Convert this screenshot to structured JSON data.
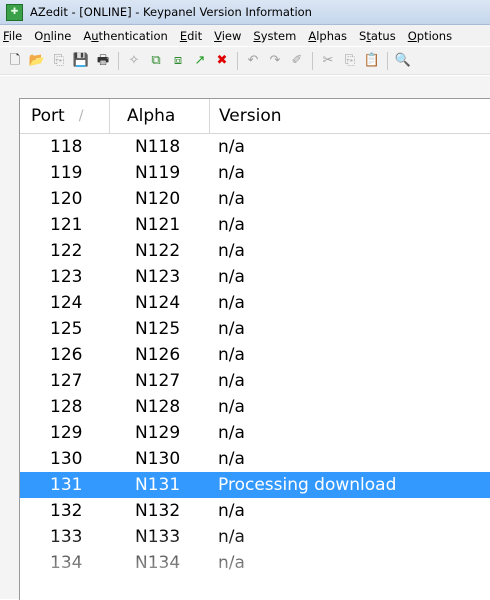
{
  "window": {
    "app_icon_glyph": "✚",
    "title": "AZedit - [ONLINE] - Keypanel Version Information"
  },
  "menu": [
    {
      "pre": "",
      "u": "F",
      "post": "ile"
    },
    {
      "pre": "O",
      "u": "n",
      "post": "line"
    },
    {
      "pre": "A",
      "u": "u",
      "post": "thentication"
    },
    {
      "pre": "",
      "u": "E",
      "post": "dit"
    },
    {
      "pre": "",
      "u": "V",
      "post": "iew"
    },
    {
      "pre": "",
      "u": "S",
      "post": "ystem"
    },
    {
      "pre": "",
      "u": "A",
      "post": "lphas"
    },
    {
      "pre": "S",
      "u": "t",
      "post": "atus"
    },
    {
      "pre": "",
      "u": "O",
      "post": "ptions"
    }
  ],
  "toolbar": [
    {
      "icon": "new-file-icon",
      "glyph": "🗋",
      "color": "#333333"
    },
    {
      "icon": "open-folder-icon",
      "glyph": "📂",
      "color": "#d9a300"
    },
    {
      "icon": "copy-file-icon",
      "glyph": "⎘",
      "color": "#9a9a9a"
    },
    {
      "icon": "save-icon",
      "glyph": "💾",
      "color": "#222222"
    },
    {
      "icon": "print-icon",
      "glyph": "🖶",
      "color": "#333333"
    },
    {
      "sep": true
    },
    {
      "icon": "wand-icon",
      "glyph": "✧",
      "color": "#9a9a9a"
    },
    {
      "icon": "copy-green-icon",
      "glyph": "⧉",
      "color": "#2e8b2e"
    },
    {
      "icon": "paste-green-icon",
      "glyph": "⧈",
      "color": "#2e8b2e"
    },
    {
      "icon": "arrow-green-icon",
      "glyph": "↗",
      "color": "#1f9a1f"
    },
    {
      "icon": "delete-icon",
      "glyph": "✖",
      "color": "#e00000"
    },
    {
      "sep": true
    },
    {
      "icon": "undo-icon",
      "glyph": "↶",
      "color": "#a0a0a0"
    },
    {
      "icon": "redo-icon",
      "glyph": "↷",
      "color": "#a0a0a0"
    },
    {
      "icon": "eraser-icon",
      "glyph": "✐",
      "color": "#a0a0a0"
    },
    {
      "sep": true
    },
    {
      "icon": "cut-icon",
      "glyph": "✂",
      "color": "#a0a0a0"
    },
    {
      "icon": "copy-icon",
      "glyph": "⎘",
      "color": "#a0a0a0"
    },
    {
      "icon": "paste-icon",
      "glyph": "📋",
      "color": "#a0a0a0"
    },
    {
      "sep": true
    },
    {
      "icon": "search-icon",
      "glyph": "🔍",
      "color": "#333333"
    }
  ],
  "table": {
    "columns": {
      "port": "Port",
      "alpha": "Alpha",
      "version": "Version"
    },
    "sort_indicator": "/",
    "rows": [
      {
        "port": "118",
        "alpha": "N118",
        "version": "n/a"
      },
      {
        "port": "119",
        "alpha": "N119",
        "version": "n/a"
      },
      {
        "port": "120",
        "alpha": "N120",
        "version": "n/a"
      },
      {
        "port": "121",
        "alpha": "N121",
        "version": "n/a"
      },
      {
        "port": "122",
        "alpha": "N122",
        "version": "n/a"
      },
      {
        "port": "123",
        "alpha": "N123",
        "version": "n/a"
      },
      {
        "port": "124",
        "alpha": "N124",
        "version": "n/a"
      },
      {
        "port": "125",
        "alpha": "N125",
        "version": "n/a"
      },
      {
        "port": "126",
        "alpha": "N126",
        "version": "n/a"
      },
      {
        "port": "127",
        "alpha": "N127",
        "version": "n/a"
      },
      {
        "port": "128",
        "alpha": "N128",
        "version": "n/a"
      },
      {
        "port": "129",
        "alpha": "N129",
        "version": "n/a"
      },
      {
        "port": "130",
        "alpha": "N130",
        "version": "n/a"
      },
      {
        "port": "131",
        "alpha": "N131",
        "version": "Processing download",
        "selected": true
      },
      {
        "port": "132",
        "alpha": "N132",
        "version": "n/a"
      },
      {
        "port": "133",
        "alpha": "N133",
        "version": "n/a"
      },
      {
        "port": "134",
        "alpha": "N134",
        "version": "n/a"
      }
    ]
  },
  "colors": {
    "selection": "#3399ff",
    "titlebar": "#c5d6ec"
  }
}
